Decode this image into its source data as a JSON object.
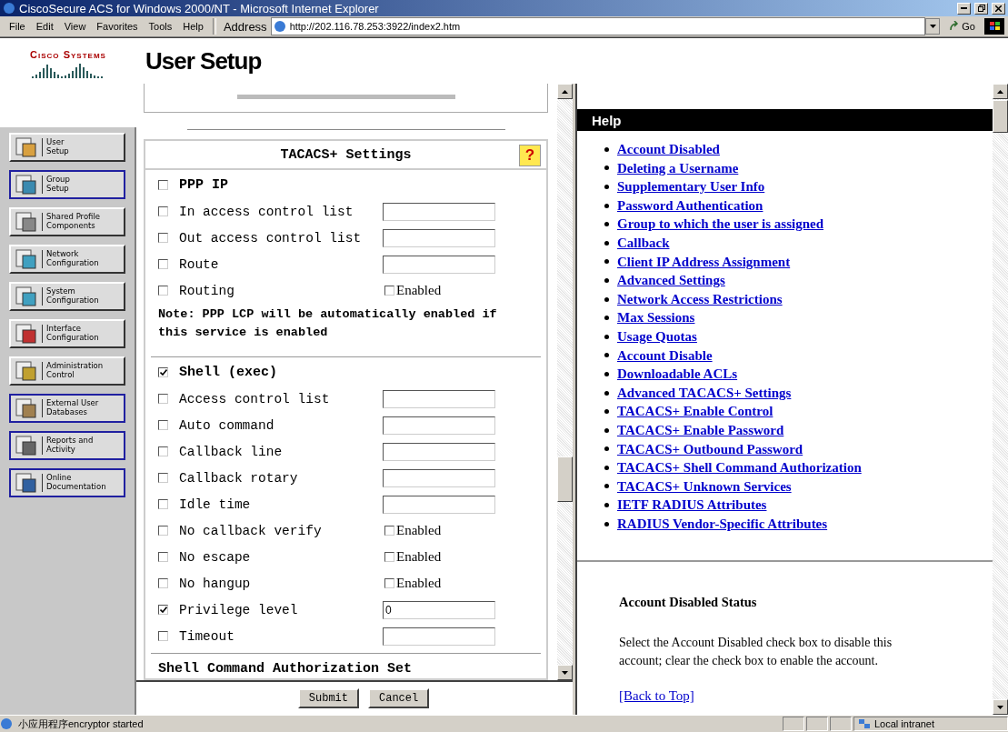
{
  "window": {
    "title": "CiscoSecure ACS for Windows 2000/NT - Microsoft Internet Explorer"
  },
  "menu": [
    "File",
    "Edit",
    "View",
    "Favorites",
    "Tools",
    "Help"
  ],
  "address": {
    "label": "Address",
    "value": "http://202.116.78.253:3922/index2.htm",
    "go": "Go"
  },
  "logo": {
    "text": "Cisco Systems"
  },
  "page_title": "User Setup",
  "nav": [
    {
      "line1": "User",
      "line2": "Setup",
      "outlined": false
    },
    {
      "line1": "Group",
      "line2": "Setup",
      "outlined": true
    },
    {
      "line1": "Shared Profile",
      "line2": "Components",
      "outlined": false
    },
    {
      "line1": "Network",
      "line2": "Configuration",
      "outlined": false
    },
    {
      "line1": "System",
      "line2": "Configuration",
      "outlined": false
    },
    {
      "line1": "Interface",
      "line2": "Configuration",
      "outlined": false
    },
    {
      "line1": "Administration",
      "line2": "Control",
      "outlined": false
    },
    {
      "line1": "External User",
      "line2": "Databases",
      "outlined": true
    },
    {
      "line1": "Reports and",
      "line2": "Activity",
      "outlined": true
    },
    {
      "line1": "Online",
      "line2": "Documentation",
      "outlined": true
    }
  ],
  "tacacs": {
    "title": "TACACS+ Settings",
    "help": "?",
    "sections": [
      {
        "rows": [
          {
            "kind": "header",
            "label": "PPP IP",
            "checked": false
          },
          {
            "kind": "text",
            "label": "In access control list",
            "checked": false
          },
          {
            "kind": "text",
            "label": "Out access control list",
            "checked": false
          },
          {
            "kind": "text",
            "label": "Route",
            "checked": false
          },
          {
            "kind": "toggle",
            "label": "Routing",
            "checked": false,
            "option": "Enabled",
            "enabled": false
          }
        ],
        "note": "Note: PPP LCP will be automatically enabled if this service is enabled"
      },
      {
        "rows": [
          {
            "kind": "header",
            "label": "Shell (exec)",
            "checked": true
          },
          {
            "kind": "text",
            "label": "Access control list",
            "checked": false
          },
          {
            "kind": "text",
            "label": "Auto command",
            "checked": false
          },
          {
            "kind": "text",
            "label": "Callback line",
            "checked": false
          },
          {
            "kind": "text",
            "label": "Callback rotary",
            "checked": false
          },
          {
            "kind": "text",
            "label": "Idle time",
            "checked": false
          },
          {
            "kind": "toggle",
            "label": "No callback verify",
            "checked": false,
            "option": "Enabled",
            "enabled": false
          },
          {
            "kind": "toggle",
            "label": "No escape",
            "checked": false,
            "option": "Enabled",
            "enabled": false
          },
          {
            "kind": "toggle",
            "label": "No hangup",
            "checked": false,
            "option": "Enabled",
            "enabled": false
          },
          {
            "kind": "text",
            "label": "Privilege level",
            "checked": true,
            "value": "0"
          },
          {
            "kind": "text",
            "label": "Timeout",
            "checked": false
          }
        ]
      }
    ],
    "next_heading": "Shell Command Authorization Set"
  },
  "buttons": [
    "Submit",
    "Cancel"
  ],
  "help": {
    "title": "Help",
    "links": [
      "Account Disabled",
      "Deleting a Username",
      "Supplementary User Info",
      "Password Authentication",
      "Group to which the user is assigned",
      "Callback",
      "Client IP Address Assignment",
      "Advanced Settings",
      "Network Access Restrictions",
      "Max Sessions",
      "Usage Quotas",
      "Account Disable",
      "Downloadable ACLs",
      "Advanced TACACS+ Settings",
      "TACACS+ Enable Control",
      "TACACS+ Enable Password",
      "TACACS+ Outbound Password",
      "TACACS+ Shell Command Authorization",
      "TACACS+ Unknown Services",
      "IETF RADIUS Attributes",
      "RADIUS Vendor-Specific Attributes"
    ],
    "section_title": "Account Disabled Status",
    "section_text": "Select the Account Disabled check box to disable this account; clear the check box to enable the account.",
    "back_link": "[Back to Top]"
  },
  "status_bar": {
    "text": "小应用程序encryptor started",
    "zone": "Local intranet"
  }
}
